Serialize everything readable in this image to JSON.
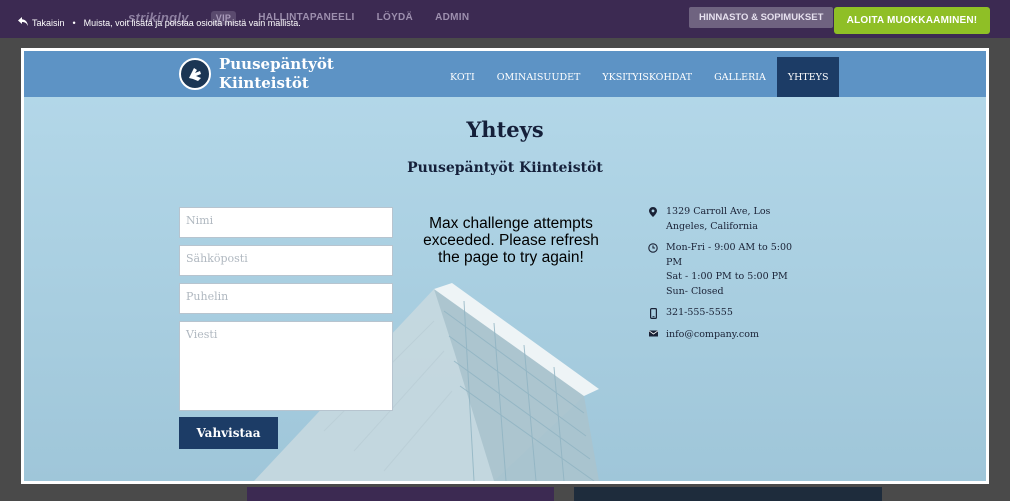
{
  "editor_bar": {
    "back_label": "Takaisin",
    "notice": "Muista, voit lisätä ja poistaa osioita mistä vain mallista.",
    "ghost_logo": "strikingly",
    "ghost_pill": "VIP",
    "ghost_nav": [
      "HALLINTAPANEELI",
      "LÖYDÄ",
      "ADMIN"
    ],
    "pricing_label": "HINNASTO & SOPIMUKSET",
    "start_label": "ALOITA MUOKKAAMINEN!",
    "colors": {
      "bar": "#3c2a52",
      "start": "#8fbf26"
    }
  },
  "site": {
    "brand_line1": "Puusepäntyöt",
    "brand_line2": "Kiinteistöt",
    "menu": [
      {
        "label": "KOTI",
        "active": false
      },
      {
        "label": "OMINAISUUDET",
        "active": false
      },
      {
        "label": "YKSITYISKOHDAT",
        "active": false
      },
      {
        "label": "GALLERIA",
        "active": false
      },
      {
        "label": "YHTEYS",
        "active": true
      }
    ],
    "heading": "Yhteys",
    "subheading": "Puusepäntyöt Kiinteistöt",
    "form": {
      "name_placeholder": "Nimi",
      "email_placeholder": "Sähköposti",
      "phone_placeholder": "Puhelin",
      "message_placeholder": "Viesti",
      "submit_label": "Vahvistaa"
    },
    "captcha_message": "Max challenge attempts exceeded. Please refresh the page to try again!",
    "contact": {
      "address": "1329 Carroll Ave, Los Angeles, California",
      "hours_1": "Mon-Fri - 9:00 AM to 5:00 PM",
      "hours_2": "Sat - 1:00 PM to 5:00 PM",
      "hours_3": "Sun- Closed",
      "phone": "321-555-5555",
      "email": "info@company.com"
    },
    "colors": {
      "nav": "#5d93c5",
      "accent": "#1c3c66"
    }
  },
  "icons": [
    "back-arrow-icon",
    "site-logo-icon",
    "map-pin-icon",
    "clock-icon",
    "phone-icon",
    "mail-icon"
  ]
}
